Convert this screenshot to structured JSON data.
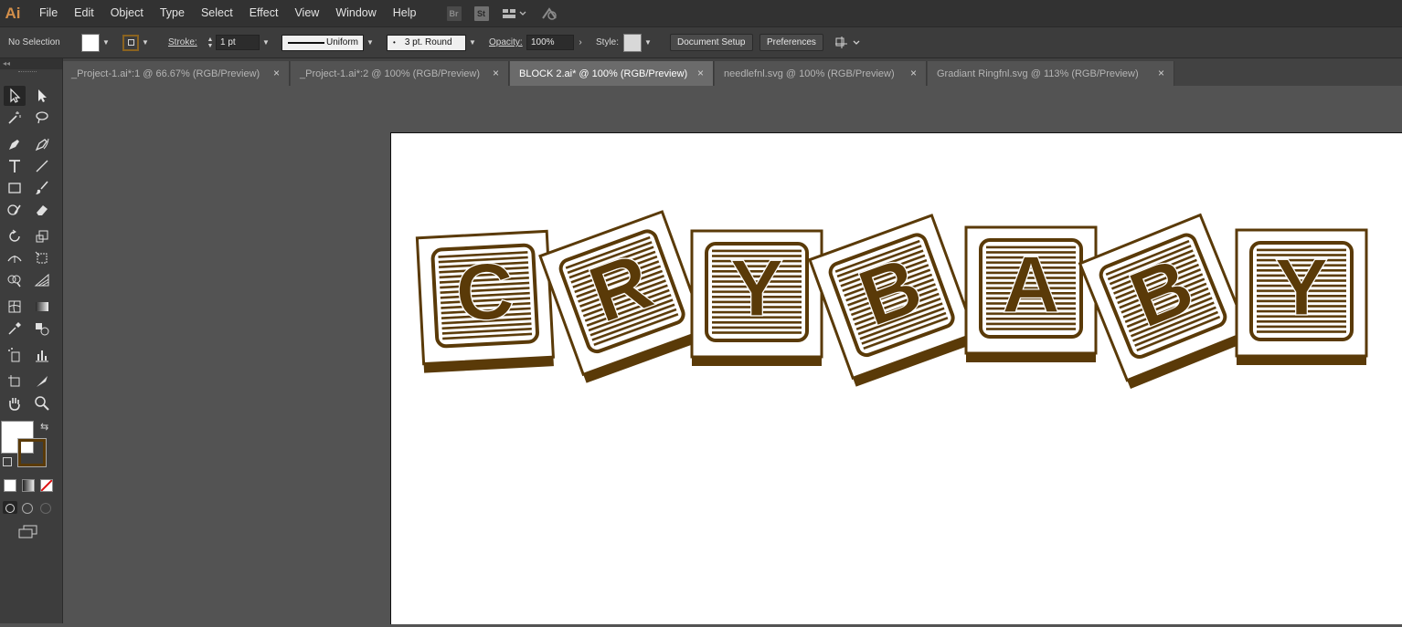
{
  "app": {
    "logo": "Ai"
  },
  "menu": [
    "File",
    "Edit",
    "Object",
    "Type",
    "Select",
    "Effect",
    "View",
    "Window",
    "Help"
  ],
  "menu_icons": [
    {
      "name": "bridge-icon",
      "label": "Br"
    },
    {
      "name": "stock-icon",
      "label": "St"
    }
  ],
  "control": {
    "selection_label": "No Selection",
    "stroke_label": "Stroke:",
    "stroke_weight": "1 pt",
    "stroke_profile": "Uniform",
    "brush": "3 pt. Round",
    "opacity_label": "Opacity:",
    "opacity_value": "100%",
    "style_label": "Style:",
    "document_setup": "Document Setup",
    "preferences": "Preferences"
  },
  "tabs": [
    {
      "label": "_Project-1.ai*:1 @ 66.67% (RGB/Preview)",
      "close": "×"
    },
    {
      "label": "_Project-1.ai*:2 @ 100% (RGB/Preview)",
      "close": "×"
    },
    {
      "label": "BLOCK 2.ai* @ 100% (RGB/Preview)",
      "close": "×"
    },
    {
      "label": "needlefnl.svg @ 100% (RGB/Preview)",
      "close": "×"
    },
    {
      "label": "Gradiant Ringfnl.svg @ 113% (RGB/Preview)",
      "close": "×"
    }
  ],
  "artwork": {
    "letters": [
      "C",
      "R",
      "Y",
      "B",
      "A",
      "B",
      "Y"
    ],
    "block_color": "#5a3a08"
  },
  "colors": {
    "fill": "#ffffff",
    "stroke": "#5a3a08",
    "accent": "#d38f4a"
  }
}
